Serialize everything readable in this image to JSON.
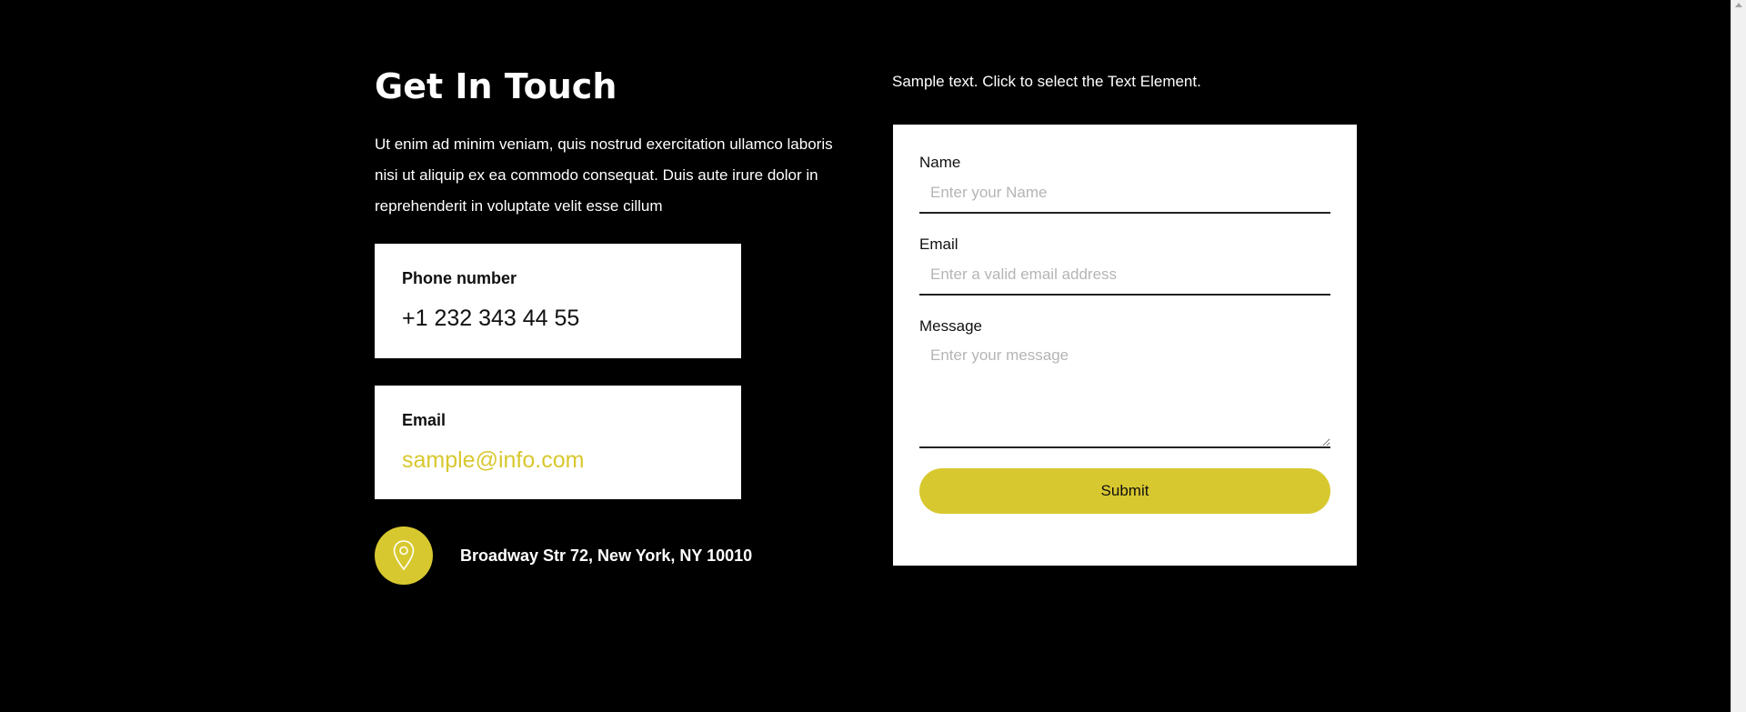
{
  "contact": {
    "title": "Get In Touch",
    "intro": "Ut enim ad minim veniam, quis nostrud exercitation ullamco laboris nisi ut aliquip ex ea commodo consequat. Duis aute irure dolor in reprehenderit in voluptate velit esse cillum",
    "phone_card": {
      "heading": "Phone number",
      "value": "+1 232 343 44 55"
    },
    "email_card": {
      "heading": "Email",
      "value": "sample@info.com"
    },
    "address": {
      "icon": "map-pin-icon",
      "text": "Broadway Str 72, New York, NY 10010"
    }
  },
  "side_note": "Sample text. Click to select the Text Element.",
  "form": {
    "name_label": "Name",
    "name_placeholder": "Enter your Name",
    "email_label": "Email",
    "email_placeholder": "Enter a valid email address",
    "message_label": "Message",
    "message_placeholder": "Enter your message",
    "submit_label": "Submit"
  },
  "colors": {
    "background": "#000000",
    "accent": "#d8c82f",
    "card": "#ffffff"
  }
}
